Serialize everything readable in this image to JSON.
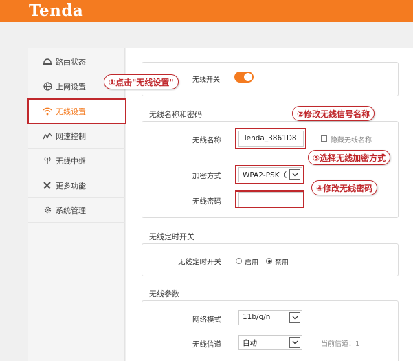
{
  "brand": {
    "logo_text": "Tenda",
    "accent": "#f47b20",
    "annotation_color": "#c0282c"
  },
  "sidebar": {
    "items": [
      {
        "label": "路由状态",
        "icon": "router-status-icon"
      },
      {
        "label": "上网设置",
        "icon": "globe-icon"
      },
      {
        "label": "无线设置",
        "icon": "wifi-icon",
        "active": true
      },
      {
        "label": "网速控制",
        "icon": "speed-chart-icon"
      },
      {
        "label": "无线中继",
        "icon": "antenna-icon"
      },
      {
        "label": "更多功能",
        "icon": "tools-icon"
      },
      {
        "label": "系统管理",
        "icon": "gear-icon"
      }
    ]
  },
  "wireless_switch": {
    "label": "无线开关",
    "on": true
  },
  "ssid_section": {
    "title": "无线名称和密码",
    "ssid_label": "无线名称",
    "ssid_value": "Tenda_3861D8",
    "hide_ssid_label": "隐藏无线名称",
    "security_label": "加密方式",
    "security_value": "WPA2-PSK（",
    "password_label": "无线密码",
    "password_value": ""
  },
  "schedule_section": {
    "title": "无线定时开关",
    "label": "无线定时开关",
    "enable_label": "启用",
    "disable_label": "禁用",
    "selected": "禁用"
  },
  "params_section": {
    "title": "无线参数",
    "mode_label": "网络模式",
    "mode_value": "11b/g/n",
    "channel_label": "无线信道",
    "channel_value": "自动",
    "current_channel_text": "当前信道：1"
  },
  "callouts": {
    "step1": "①点击\"无线设置\"",
    "step2": "②修改无线信号名称",
    "step3": "③选择无线加密方式",
    "step4": "④修改无线密码"
  }
}
